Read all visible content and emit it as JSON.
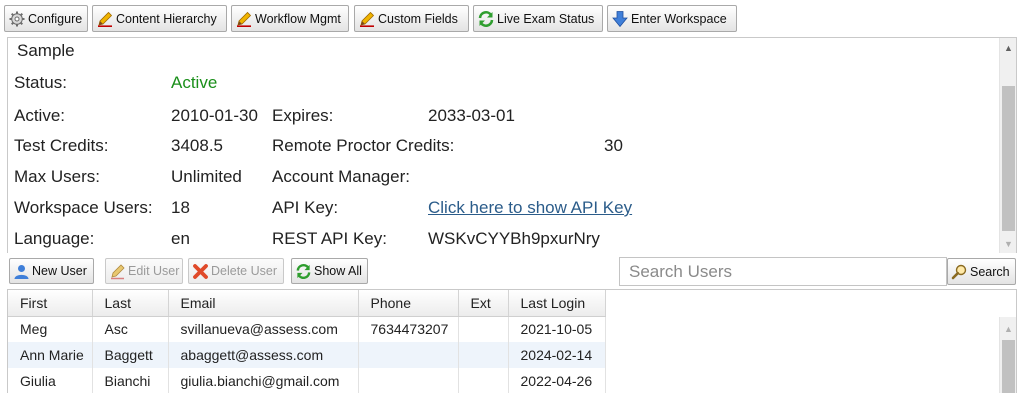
{
  "toolbar": {
    "buttons": [
      {
        "label": "Configure",
        "icon": "gear-icon"
      },
      {
        "label": "Content Hierarchy",
        "icon": "pencil-icon"
      },
      {
        "label": "Workflow Mgmt",
        "icon": "pencil-icon"
      },
      {
        "label": "Custom Fields",
        "icon": "pencil-icon"
      },
      {
        "label": "Live Exam Status",
        "icon": "refresh-icon"
      },
      {
        "label": "Enter Workspace",
        "icon": "arrow-down-icon"
      }
    ]
  },
  "workspace": {
    "title": "Sample",
    "status_label": "Status:",
    "status_value": "Active",
    "active_label": "Active:",
    "active_value": "2010-01-30",
    "expires_label": "Expires:",
    "expires_value": "2033-03-01",
    "credits_label": "Test Credits:",
    "credits_value": "3408.5",
    "proctor_label": "Remote Proctor Credits:",
    "proctor_value": "30",
    "maxusers_label": "Max Users:",
    "maxusers_value": "Unlimited",
    "manager_label": "Account Manager:",
    "manager_value": "",
    "wsusers_label": "Workspace Users:",
    "wsusers_value": "18",
    "apikey_label": "API Key:",
    "apikey_value": "Click here to show API Key",
    "language_label": "Language:",
    "language_value": "en",
    "restkey_label": "REST API Key:",
    "restkey_value": "WSKvCYYBh9pxurNry"
  },
  "users_toolbar": {
    "new_user": "New User",
    "edit_user": "Edit User",
    "delete_user": "Delete User",
    "show_all": "Show All",
    "search_placeholder": "Search Users",
    "search_button": "Search"
  },
  "grid": {
    "columns": [
      "First",
      "Last",
      "Email",
      "Phone",
      "Ext",
      "Last Login"
    ],
    "rows": [
      {
        "first": "Meg",
        "last": "Asc",
        "email": "svillanueva@assess.com",
        "phone": "7634473207",
        "ext": "",
        "login": "2021-10-05"
      },
      {
        "first": "Ann Marie",
        "last": "Baggett",
        "email": "abaggett@assess.com",
        "phone": "",
        "ext": "",
        "login": "2024-02-14"
      },
      {
        "first": "Giulia",
        "last": "Bianchi",
        "email": "giulia.bianchi@gmail.com",
        "phone": "",
        "ext": "",
        "login": "2022-04-26"
      }
    ]
  },
  "colors": {
    "active_status": "#1a8f1a",
    "link": "#2b5c8a",
    "alt_row": "#eef4fb"
  }
}
